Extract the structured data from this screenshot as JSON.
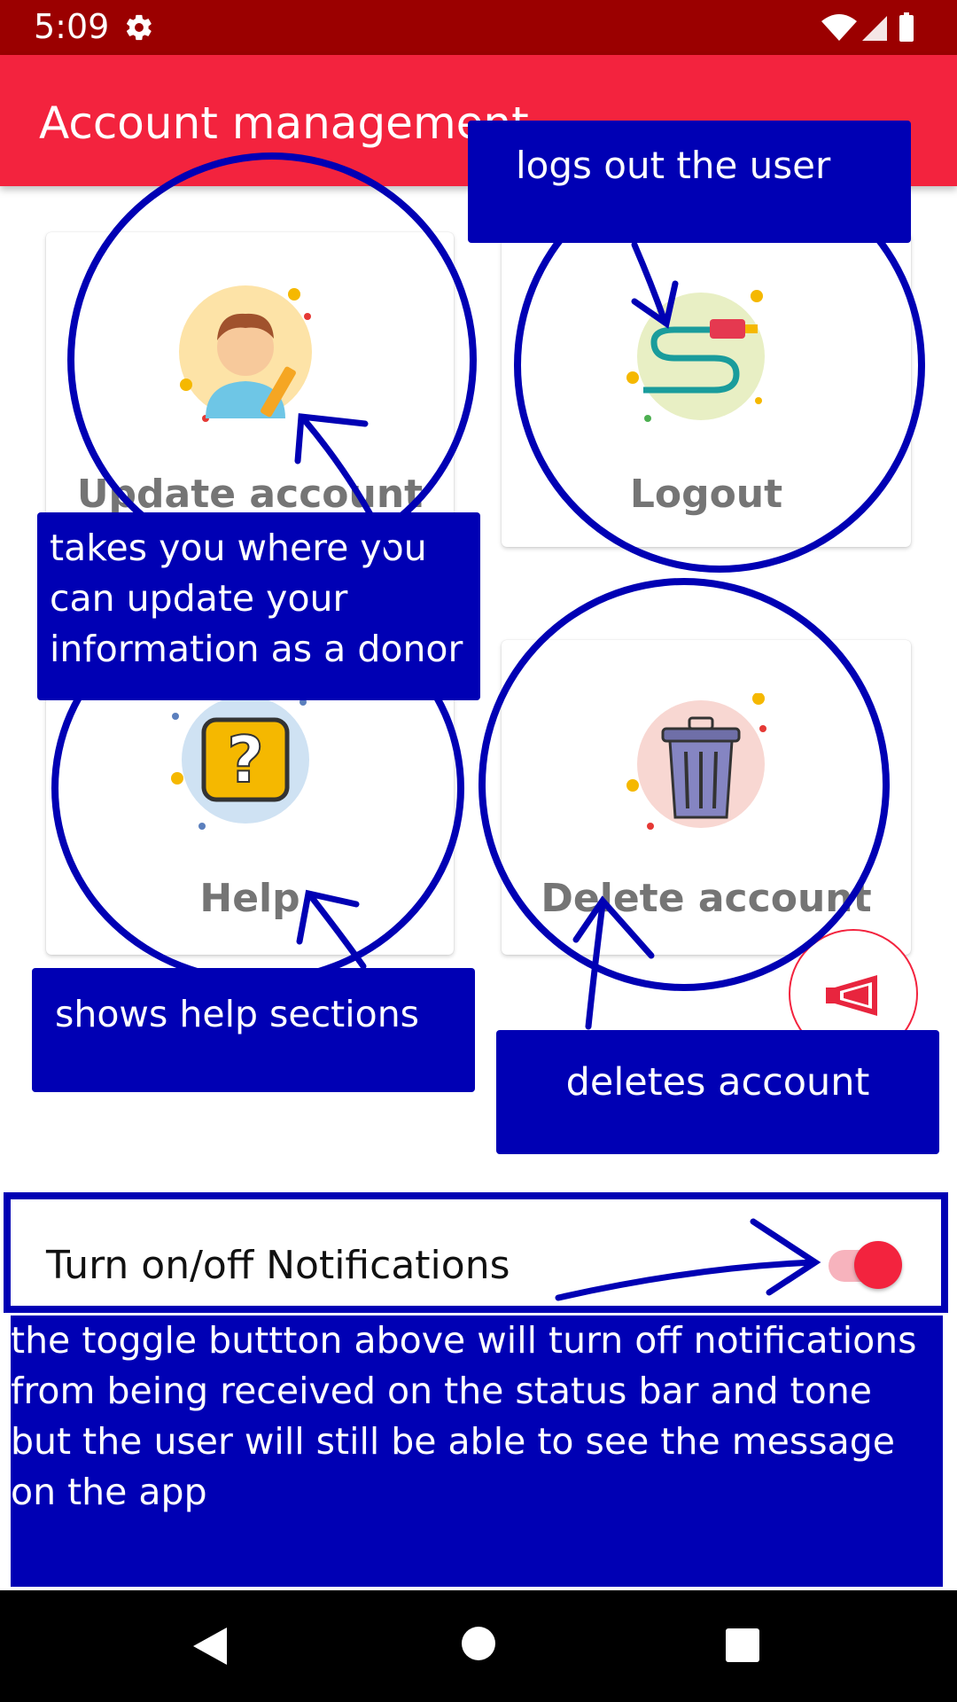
{
  "status_bar": {
    "time": "5:09"
  },
  "app_bar": {
    "title": "Account management"
  },
  "cards": [
    {
      "label": "Update account",
      "icon": "user-edit-icon"
    },
    {
      "label": "Logout",
      "icon": "plug-cable-icon"
    },
    {
      "label": "Help",
      "icon": "question-icon"
    },
    {
      "label": "Delete account",
      "icon": "trash-can-icon"
    }
  ],
  "annotations": {
    "logout": "logs out the user",
    "update": "takes you where you can update your information as a donor",
    "help": "shows help sections",
    "delete": "deletes account",
    "toggle": "the  toggle buttton above will turn off notifications from being received on the status bar and tone but the user will still be able to see the message on the app"
  },
  "notifications": {
    "label": "Turn on/off Notifications",
    "enabled": true
  },
  "colors": {
    "accent": "#f3233e",
    "status_bar": "#9b0000",
    "annotation": "#0000b4"
  }
}
